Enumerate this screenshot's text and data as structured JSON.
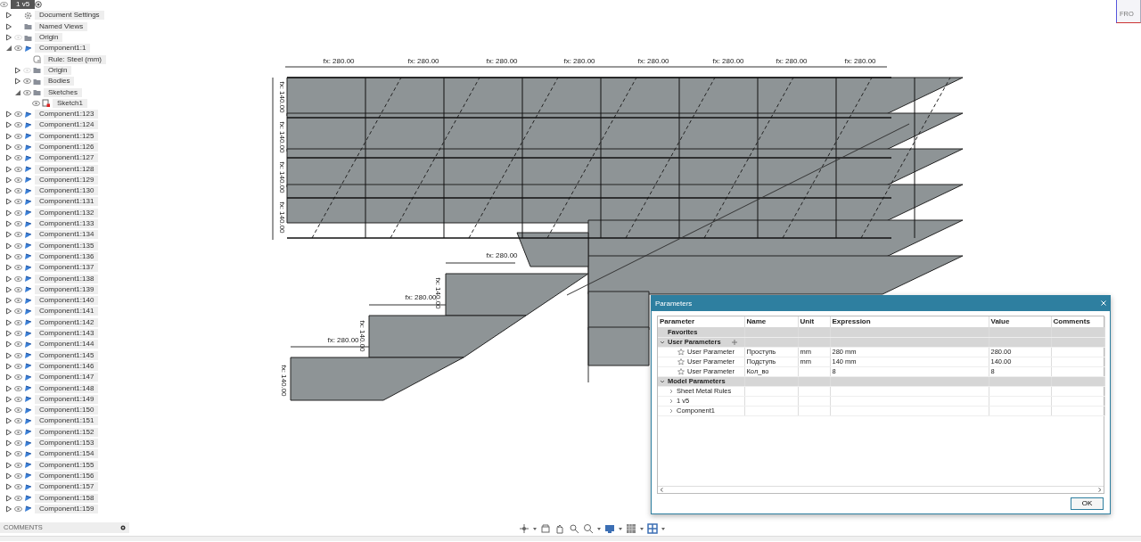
{
  "browser": {
    "root": {
      "label": "1 v5"
    },
    "items": [
      {
        "label": "Document Settings",
        "kind": "settings",
        "expanded": false
      },
      {
        "label": "Named Views",
        "kind": "folder",
        "expanded": false
      },
      {
        "label": "Origin",
        "kind": "folder",
        "expanded": false,
        "visible": false
      },
      {
        "label": "Component1:1",
        "kind": "component",
        "expanded": true,
        "visible": true,
        "children": [
          {
            "label": "Rule: Steel (mm)",
            "kind": "rule"
          },
          {
            "label": "Origin",
            "kind": "folder",
            "expanded": false,
            "visible": false
          },
          {
            "label": "Bodies",
            "kind": "folder",
            "expanded": false,
            "visible": true
          },
          {
            "label": "Sketches",
            "kind": "folder",
            "expanded": true,
            "visible": true,
            "children": [
              {
                "label": "Sketch1",
                "kind": "sketch",
                "visible": true
              }
            ]
          }
        ]
      },
      {
        "label": "Component1:123",
        "kind": "component",
        "expanded": false,
        "visible": true
      },
      {
        "label": "Component1:124",
        "kind": "component",
        "expanded": false,
        "visible": true
      },
      {
        "label": "Component1:125",
        "kind": "component",
        "expanded": false,
        "visible": true
      },
      {
        "label": "Component1:126",
        "kind": "component",
        "expanded": false,
        "visible": true
      },
      {
        "label": "Component1:127",
        "kind": "component",
        "expanded": false,
        "visible": true
      },
      {
        "label": "Component1:128",
        "kind": "component",
        "expanded": false,
        "visible": true
      },
      {
        "label": "Component1:129",
        "kind": "component",
        "expanded": false,
        "visible": true
      },
      {
        "label": "Component1:130",
        "kind": "component",
        "expanded": false,
        "visible": true
      },
      {
        "label": "Component1:131",
        "kind": "component",
        "expanded": false,
        "visible": true
      },
      {
        "label": "Component1:132",
        "kind": "component",
        "expanded": false,
        "visible": true
      },
      {
        "label": "Component1:133",
        "kind": "component",
        "expanded": false,
        "visible": true
      },
      {
        "label": "Component1:134",
        "kind": "component",
        "expanded": false,
        "visible": true
      },
      {
        "label": "Component1:135",
        "kind": "component",
        "expanded": false,
        "visible": true
      },
      {
        "label": "Component1:136",
        "kind": "component",
        "expanded": false,
        "visible": true
      },
      {
        "label": "Component1:137",
        "kind": "component",
        "expanded": false,
        "visible": true
      },
      {
        "label": "Component1:138",
        "kind": "component",
        "expanded": false,
        "visible": true
      },
      {
        "label": "Component1:139",
        "kind": "component",
        "expanded": false,
        "visible": true
      },
      {
        "label": "Component1:140",
        "kind": "component",
        "expanded": false,
        "visible": true
      },
      {
        "label": "Component1:141",
        "kind": "component",
        "expanded": false,
        "visible": true
      },
      {
        "label": "Component1:142",
        "kind": "component",
        "expanded": false,
        "visible": true
      },
      {
        "label": "Component1:143",
        "kind": "component",
        "expanded": false,
        "visible": true
      },
      {
        "label": "Component1:144",
        "kind": "component",
        "expanded": false,
        "visible": true
      },
      {
        "label": "Component1:145",
        "kind": "component",
        "expanded": false,
        "visible": true
      },
      {
        "label": "Component1:146",
        "kind": "component",
        "expanded": false,
        "visible": true
      },
      {
        "label": "Component1:147",
        "kind": "component",
        "expanded": false,
        "visible": true
      },
      {
        "label": "Component1:148",
        "kind": "component",
        "expanded": false,
        "visible": true
      },
      {
        "label": "Component1:149",
        "kind": "component",
        "expanded": false,
        "visible": true
      },
      {
        "label": "Component1:150",
        "kind": "component",
        "expanded": false,
        "visible": true
      },
      {
        "label": "Component1:151",
        "kind": "component",
        "expanded": false,
        "visible": true
      },
      {
        "label": "Component1:152",
        "kind": "component",
        "expanded": false,
        "visible": true
      },
      {
        "label": "Component1:153",
        "kind": "component",
        "expanded": false,
        "visible": true
      },
      {
        "label": "Component1:154",
        "kind": "component",
        "expanded": false,
        "visible": true
      },
      {
        "label": "Component1:155",
        "kind": "component",
        "expanded": false,
        "visible": true
      },
      {
        "label": "Component1:156",
        "kind": "component",
        "expanded": false,
        "visible": true
      },
      {
        "label": "Component1:157",
        "kind": "component",
        "expanded": false,
        "visible": true
      },
      {
        "label": "Component1:158",
        "kind": "component",
        "expanded": false,
        "visible": true
      },
      {
        "label": "Component1:159",
        "kind": "component",
        "expanded": false,
        "visible": true
      }
    ]
  },
  "comments": {
    "label": "COMMENTS"
  },
  "viewcube": {
    "label": "FRO"
  },
  "sketch": {
    "top_dimensions": [
      "fx: 280.00",
      "fx: 280.00",
      "fx: 280.00",
      "fx: 280.00",
      "fx: 280.00",
      "fx: 280.00",
      "fx: 280.00",
      "fx: 280.00"
    ],
    "left_dimensions": [
      "fx: 140.00",
      "fx: 140.00",
      "fx: 140.00",
      "fx: 140.00"
    ],
    "step_dimensions": [
      {
        "tread": "fx: 280.00",
        "riser": "fx: 140.00"
      },
      {
        "tread": "fx: 280.00",
        "riser": "fx: 140.00"
      },
      {
        "tread": "fx: 280.00",
        "riser": "fx: 140.00"
      }
    ]
  },
  "dialog": {
    "title": "Parameters",
    "columns": [
      "Parameter",
      "Name",
      "Unit",
      "Expression",
      "Value",
      "Comments"
    ],
    "groups": [
      {
        "label": "Favorites"
      },
      {
        "label": "User Parameters",
        "expanded": true,
        "rows": [
          {
            "parameter": "User Parameter",
            "name": "Проступь",
            "unit": "mm",
            "expression": "280 mm",
            "value": "280.00"
          },
          {
            "parameter": "User Parameter",
            "name": "Подступь",
            "unit": "mm",
            "expression": "140 mm",
            "value": "140.00"
          },
          {
            "parameter": "User Parameter",
            "name": "Кол_во",
            "expression": "8",
            "value": "8"
          }
        ]
      },
      {
        "label": "Model Parameters",
        "expanded": true,
        "children": [
          {
            "label": "Sheet Metal Rules",
            "expanded": false
          },
          {
            "label": "1 v5",
            "expanded": false
          },
          {
            "label": "Component1",
            "expanded": false
          }
        ]
      }
    ],
    "ok": "OK"
  }
}
